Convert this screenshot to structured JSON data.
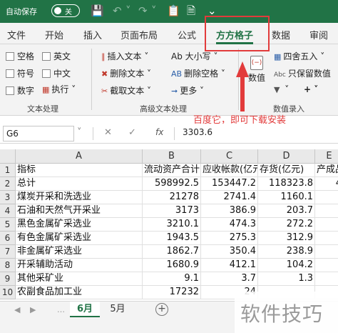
{
  "titlebar": {
    "autosave_label": "自动保存",
    "toggle_state": "关"
  },
  "tabs": [
    "文件",
    "开始",
    "插入",
    "页面布局",
    "公式",
    "方方格子",
    "数据",
    "审阅"
  ],
  "active_tab": "方方格子",
  "ribbon": {
    "text_group": {
      "checkboxes": [
        "空格",
        "英文",
        "符号",
        "中文",
        "数字"
      ],
      "exec_label": "执行",
      "label": "文本处理"
    },
    "advanced_group": {
      "insert_text": "插入文本",
      "delete_text": "删除文本",
      "extract_text": "截取文本",
      "case_label": "Ab 大小写",
      "delete_spaces": "删除空格",
      "more": "更多",
      "label": "高级文本处理"
    },
    "number_group": {
      "value_label": "数值",
      "round_label": "四舍五入",
      "keep_value": "只保留数值",
      "abc_icon_text": "Abc",
      "plus_label": "+",
      "label": "数值录入"
    }
  },
  "annotation": "百度它，即可下载安装",
  "formula_bar": {
    "cell_ref": "G6",
    "fx_label": "fx",
    "value": "3303.6"
  },
  "grid": {
    "columns": [
      "A",
      "B",
      "C",
      "D",
      "E"
    ],
    "rows": [
      {
        "n": "1",
        "cells": [
          "指标",
          "流动资产合计",
          "应收帐款(亿元)",
          "存货(亿元)",
          "产成品"
        ]
      },
      {
        "n": "2",
        "cells": [
          "总计",
          "598992.5",
          "153447.2",
          "118323.8",
          "4"
        ]
      },
      {
        "n": "3",
        "cells": [
          "煤炭开采和洗选业",
          "21278",
          "2741.4",
          "1160.1",
          ""
        ]
      },
      {
        "n": "4",
        "cells": [
          "石油和天然气开采业",
          "3173",
          "386.9",
          "203.7",
          ""
        ]
      },
      {
        "n": "5",
        "cells": [
          "黑色金属矿采选业",
          "3210.1",
          "474.3",
          "272.2",
          ""
        ]
      },
      {
        "n": "6",
        "cells": [
          "有色金属矿采选业",
          "1943.5",
          "275.3",
          "312.9",
          ""
        ]
      },
      {
        "n": "7",
        "cells": [
          "非金属矿采选业",
          "1862.7",
          "350.4",
          "238.9",
          ""
        ]
      },
      {
        "n": "8",
        "cells": [
          "开采辅助活动",
          "1680.9",
          "412.1",
          "104.2",
          ""
        ]
      },
      {
        "n": "9",
        "cells": [
          "其他采矿业",
          "9.1",
          "3.7",
          "1.3",
          ""
        ]
      },
      {
        "n": "10",
        "cells": [
          "农副食品加工业",
          "17232",
          "24",
          "",
          ""
        ]
      }
    ]
  },
  "sheets": [
    "6月",
    "5月"
  ],
  "active_sheet": "6月",
  "watermark": "软件技巧",
  "colors": {
    "excel_green": "#217346",
    "annotation_red": "#e23b3b"
  }
}
